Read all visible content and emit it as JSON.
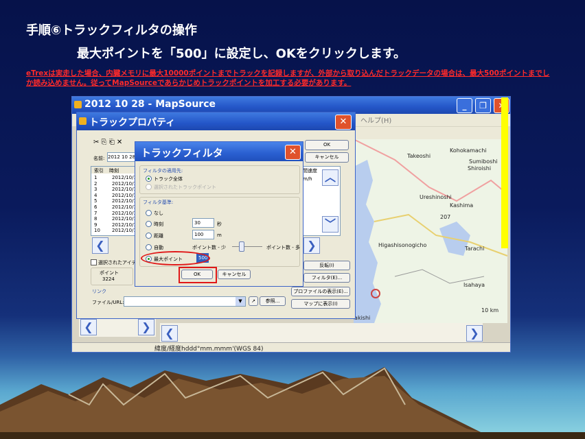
{
  "slide": {
    "heading": "手順⑥トラックフィルタの操作",
    "instruction": "最大ポイントを「500」に設定し、OKをクリックします。",
    "note": "eTrexは実走した場合、内臓メモリに最大10000ポイントまでトラックを記録しますが、外部から取り込んだトラックデータの場合は、最大500ポイントまでしか読み込めません。従ってMapSourceであらかじめトラックポイントを加工する必要があります。"
  },
  "mapsource": {
    "title": "2012 10 28 - MapSource",
    "help_menu": "ヘルプ(H)",
    "status": "緯度/経度hddd°mm.mmm'(WGS 84)",
    "map_labels": [
      "Kohokamachi",
      "Takeoshi",
      "Sumiboshi",
      "Shiroishi",
      "Ureshinoshi",
      "Kashima",
      "Higashisonogicho",
      "Tarachi",
      "Isahaya",
      "Nagasakishi",
      "10 km",
      "207"
    ]
  },
  "track_properties": {
    "title": "トラックプロパティ",
    "name_label": "名前:",
    "name_value": "2012 10 28",
    "ok_label": "OK",
    "cancel_label": "キャンセル",
    "columns": [
      "索引",
      "時刻"
    ],
    "rows": [
      {
        "index": "1",
        "time": "2012/10/1"
      },
      {
        "index": "2",
        "time": "2012/10/1"
      },
      {
        "index": "3",
        "time": "2012/10/1"
      },
      {
        "index": "4",
        "time": "2012/10/1"
      },
      {
        "index": "5",
        "time": "2012/10/1"
      },
      {
        "index": "6",
        "time": "2012/10/1"
      },
      {
        "index": "7",
        "time": "2012/10/1"
      },
      {
        "index": "8",
        "time": "2012/10/1"
      },
      {
        "index": "9",
        "time": "2012/10/1"
      },
      {
        "index": "10",
        "time": "2012/10/1"
      }
    ],
    "right_col_header": "間速度",
    "right_col_unit": "m/h",
    "only_selected_label": "選択されたアイテム",
    "points_label": "ポイント",
    "points_value": "3224",
    "reverse_button": "反転(I)",
    "filter_button": "フィルタ(E)...",
    "show_profile_button": "プロファイルの表示(E)...",
    "show_map_button": "マップに表示(I)",
    "link_label": "リンク",
    "file_url_label": "ファイル/URL:",
    "browse_button": "参照..."
  },
  "track_filter": {
    "title": "トラックフィルタ",
    "apply_group": "フィルタの適用先:",
    "apply_all": "トラック全体",
    "apply_selected": "選択されたトラックポイント",
    "criteria_group": "フィルタ基準:",
    "none_label": "なし",
    "time_label": "時刻",
    "time_value": "30",
    "time_unit": "秒",
    "distance_label": "距離",
    "distance_value": "100",
    "distance_unit": "m",
    "auto_label": "自動",
    "auto_few": "ポイント数 - 少",
    "auto_many": "ポイント数 - 多",
    "max_points_label": "最大ポイント",
    "max_points_value": "500",
    "ok_label": "OK",
    "cancel_label": "キャンセル"
  }
}
